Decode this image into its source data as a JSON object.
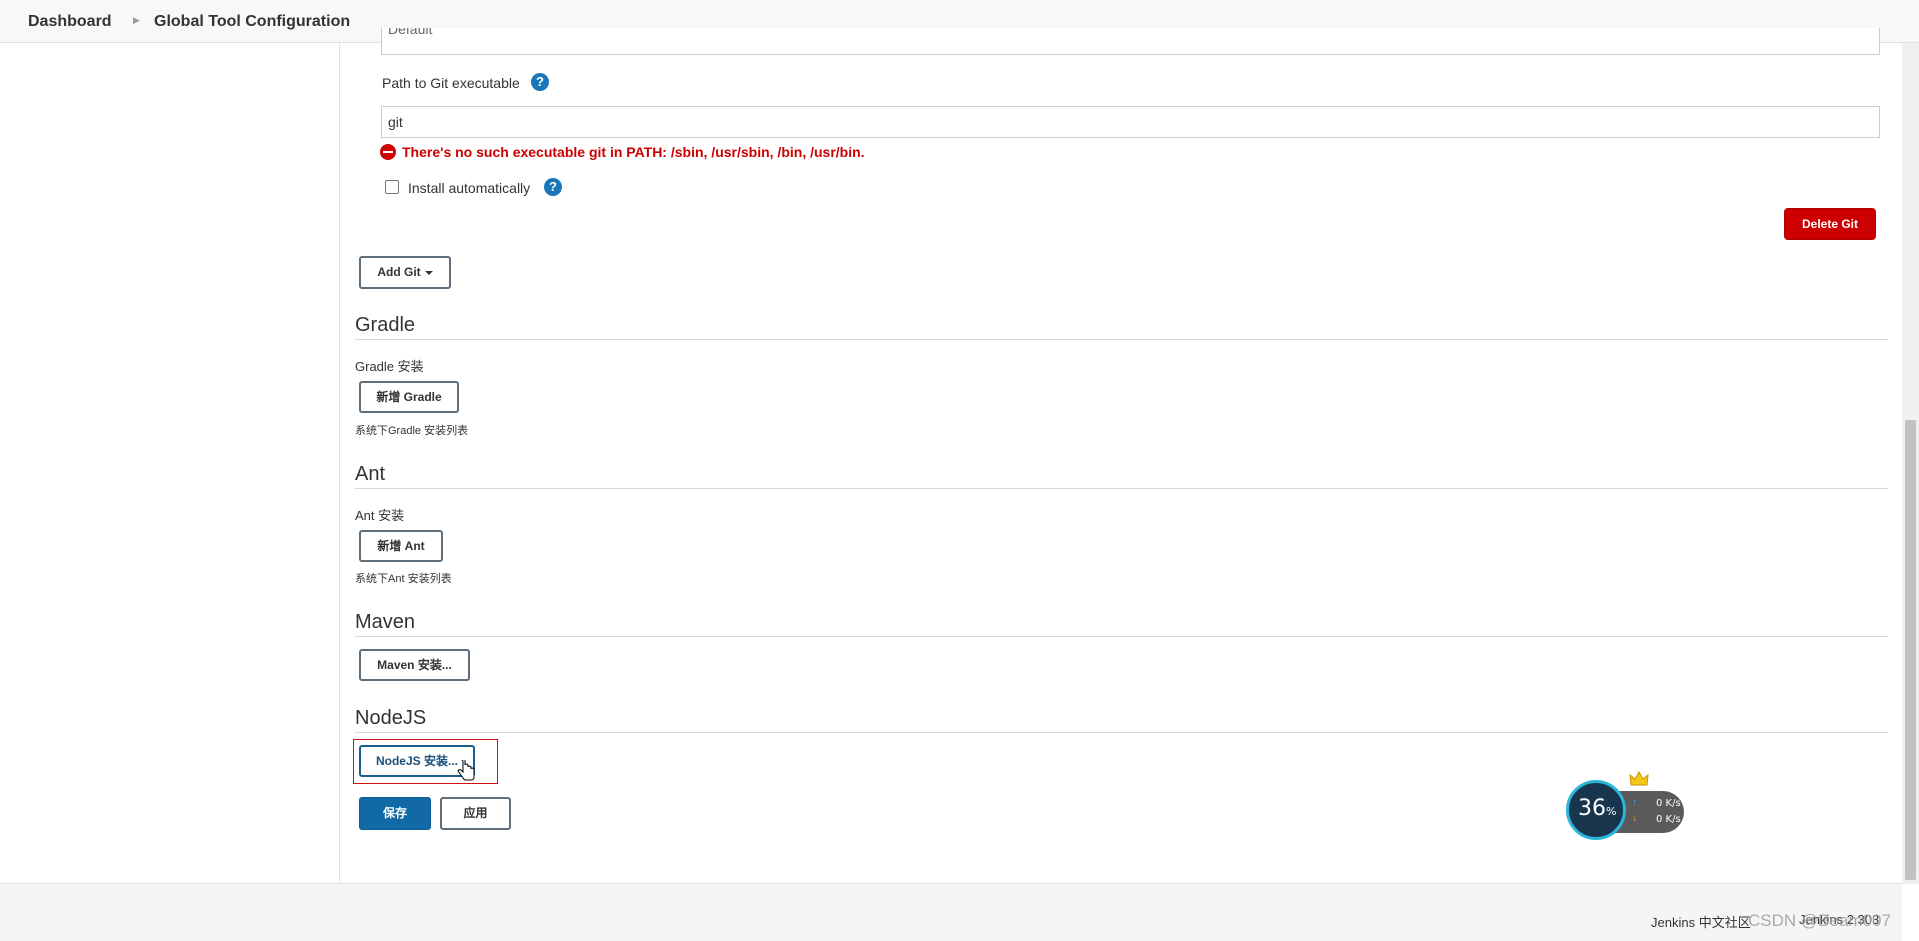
{
  "breadcrumb": {
    "items": [
      "Dashboard",
      "Global Tool Configuration"
    ]
  },
  "git": {
    "name_value": "Default",
    "path_label": "Path to Git executable",
    "path_value": "git",
    "error_message": "There's no such executable git in PATH: /sbin, /usr/sbin, /bin, /usr/bin.",
    "install_auto_label": "Install automatically",
    "install_auto_checked": false,
    "delete_label": "Delete Git",
    "add_label": "Add Git"
  },
  "gradle": {
    "title": "Gradle",
    "install_label": "Gradle 安装",
    "add_label": "新增 Gradle",
    "desc": "系统下Gradle 安装列表"
  },
  "ant": {
    "title": "Ant",
    "install_label": "Ant 安装",
    "add_label": "新增 Ant",
    "desc": "系统下Ant 安装列表"
  },
  "maven": {
    "title": "Maven",
    "install_button": "Maven 安装..."
  },
  "nodejs": {
    "title": "NodeJS",
    "install_button": "NodeJS 安装..."
  },
  "actions": {
    "save_label": "保存",
    "apply_label": "应用"
  },
  "net_widget": {
    "percent": "36",
    "percent_unit": "%",
    "upload": "0 K/s",
    "download": "0 K/s"
  },
  "footer": {
    "community_link": "Jenkins 中文社区",
    "version": "Jenkins 2.303"
  },
  "watermark": "CSDN @Beam007",
  "colors": {
    "primary_blue": "#116aa6",
    "danger_red": "#cc0000",
    "help_blue": "#1976b8"
  }
}
